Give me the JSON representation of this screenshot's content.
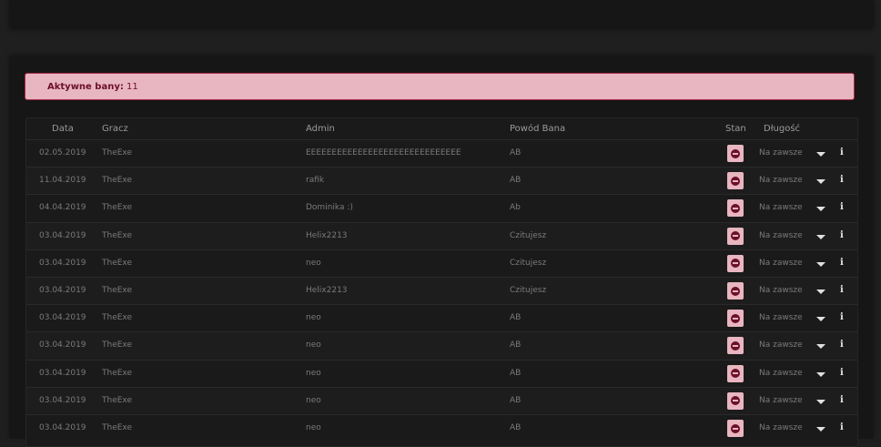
{
  "alert": {
    "label": "Aktywne bany:",
    "count": "11"
  },
  "columns": {
    "date": "Data",
    "player": "Gracz",
    "admin": "Admin",
    "reason": "Powód Bana",
    "status": "Stan",
    "length": "Długość"
  },
  "rows": [
    {
      "date": "02.05.2019",
      "player": "TheExe",
      "admin": "EEEEEEEEEEEEEEEEEEEEEEEEEEEEEE",
      "reason": "AB",
      "length": "Na zawsze"
    },
    {
      "date": "11.04.2019",
      "player": "TheExe",
      "admin": "rafik",
      "reason": "AB",
      "length": "Na zawsze"
    },
    {
      "date": "04.04.2019",
      "player": "TheExe",
      "admin": "Dominika :)",
      "reason": "Ab",
      "length": "Na zawsze"
    },
    {
      "date": "03.04.2019",
      "player": "TheExe",
      "admin": "Helix2213",
      "reason": "Czitujesz",
      "length": "Na zawsze"
    },
    {
      "date": "03.04.2019",
      "player": "TheExe",
      "admin": "neo",
      "reason": "Czitujesz",
      "length": "Na zawsze"
    },
    {
      "date": "03.04.2019",
      "player": "TheExe",
      "admin": "Helix2213",
      "reason": "Czitujesz",
      "length": "Na zawsze"
    },
    {
      "date": "03.04.2019",
      "player": "TheExe",
      "admin": "neo",
      "reason": "AB",
      "length": "Na zawsze"
    },
    {
      "date": "03.04.2019",
      "player": "TheExe",
      "admin": "neo",
      "reason": "AB",
      "length": "Na zawsze"
    },
    {
      "date": "03.04.2019",
      "player": "TheExe",
      "admin": "neo",
      "reason": "AB",
      "length": "Na zawsze"
    },
    {
      "date": "03.04.2019",
      "player": "TheExe",
      "admin": "neo",
      "reason": "AB",
      "length": "Na zawsze"
    },
    {
      "date": "03.04.2019",
      "player": "TheExe",
      "admin": "neo",
      "reason": "AB",
      "length": "Na zawsze"
    }
  ],
  "icons": {
    "status": "no-entry-icon",
    "expand": "caret-down-icon",
    "details": "info-icon"
  },
  "colors": {
    "accent": "#e8b6c0",
    "accent_dark": "#6b1028",
    "border": "#ab2b4e"
  }
}
